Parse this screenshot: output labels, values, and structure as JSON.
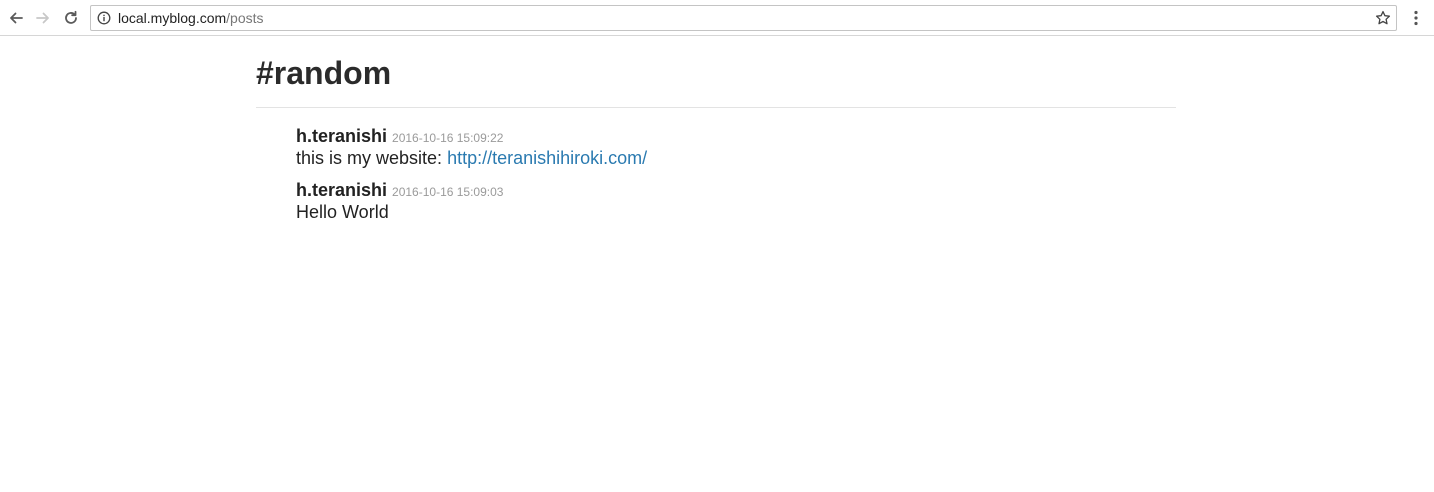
{
  "browser": {
    "url_host": "local.myblog.com",
    "url_path": "/posts",
    "icons": {
      "back": "back-arrow-icon",
      "forward": "forward-arrow-icon",
      "reload": "reload-icon",
      "info": "info-icon",
      "bookmark": "star-icon",
      "menu": "kebab-menu-icon"
    }
  },
  "page": {
    "channel_title": "#random",
    "link_color": "#2a7ab0"
  },
  "posts": [
    {
      "author": "h.teranishi",
      "timestamp": "2016-10-16 15:09:22",
      "text": "this is my website:",
      "link": "http://teranishihiroki.com/"
    },
    {
      "author": "h.teranishi",
      "timestamp": "2016-10-16 15:09:03",
      "text": "Hello World"
    }
  ]
}
